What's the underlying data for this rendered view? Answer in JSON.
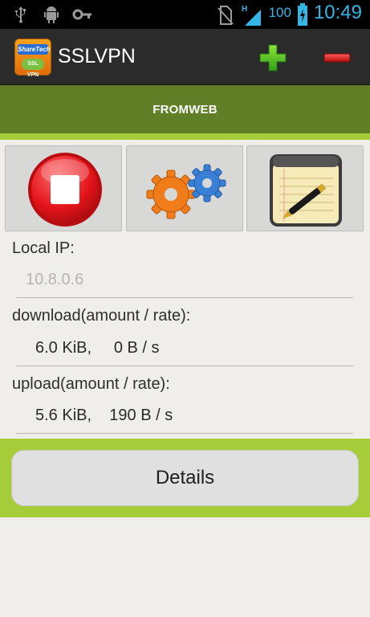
{
  "status_bar": {
    "icons_left": [
      "usb-icon",
      "android-debug-icon",
      "vpn-key-icon"
    ],
    "icons_right": [
      "no-sim-icon",
      "signal-h-icon",
      "battery-charging-icon"
    ],
    "network_type": "H",
    "battery_percent": "100",
    "time": "10:49"
  },
  "action_bar": {
    "logo_text_top": "ShareTech",
    "logo_text_bottom": "SSL VPN",
    "title": "SSLVPN",
    "add_icon": "plus-icon",
    "remove_icon": "minus-icon"
  },
  "profile": {
    "name": "FROMWEB"
  },
  "toolbar": {
    "buttons": [
      {
        "icon": "stop-icon",
        "color": "#e8161c"
      },
      {
        "icon": "gears-icon",
        "color": "#f07d1a"
      },
      {
        "icon": "notepad-pen-icon",
        "color": "#f4e9b2"
      }
    ]
  },
  "info": {
    "local_ip_label": "Local IP:",
    "local_ip_value": "10.8.0.6",
    "download_label": "download(amount / rate):",
    "download_value": "6.0 KiB,     0 B / s",
    "upload_label": "upload(amount / rate):",
    "upload_value": "5.6 KiB,    190 B / s"
  },
  "details": {
    "label": "Details"
  },
  "colors": {
    "status_accent": "#33b5e5",
    "profile_bar": "#607f26",
    "accent_green": "#a6cc39",
    "action_bar": "#2b2b2b"
  }
}
